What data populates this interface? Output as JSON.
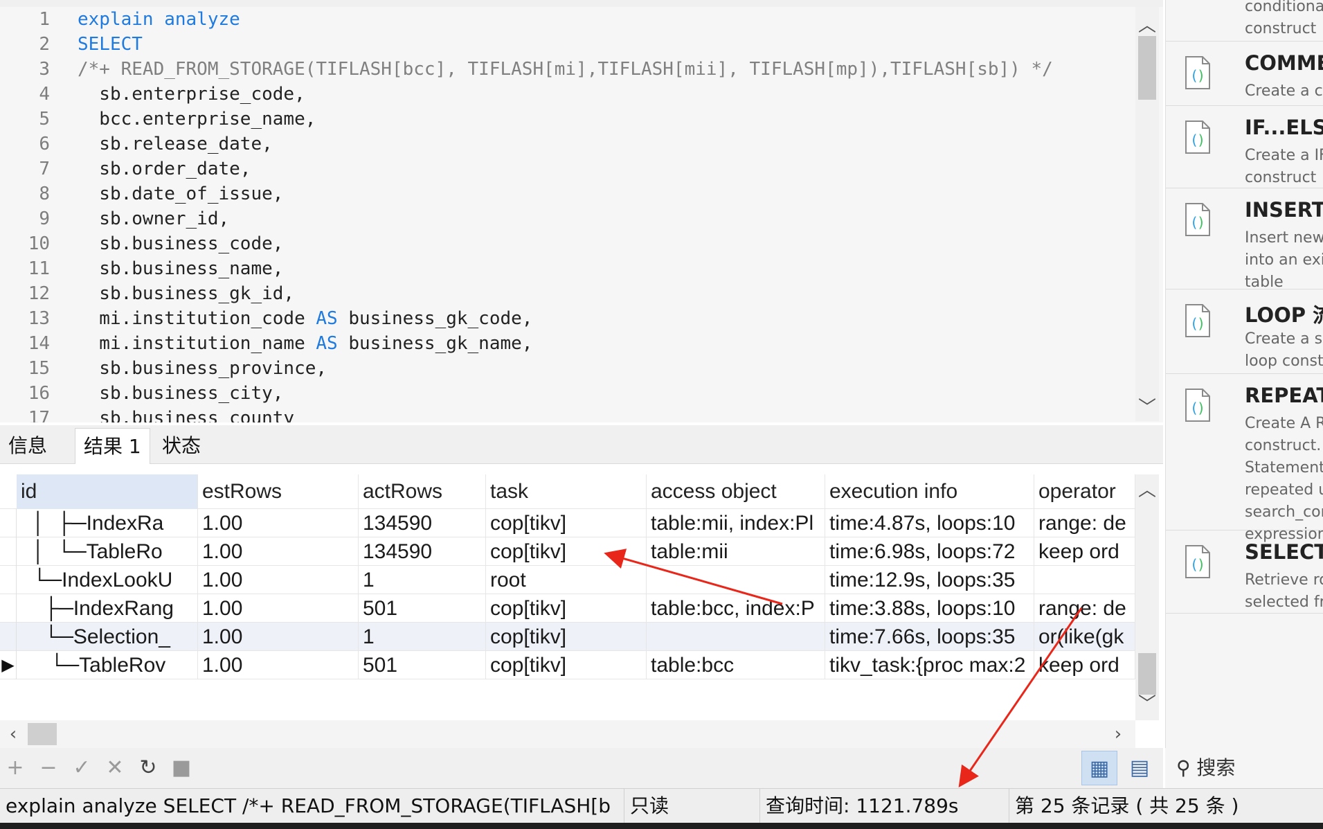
{
  "editor": {
    "lines": [
      {
        "num": "1",
        "parts": [
          {
            "t": "explain analyze",
            "c": "kw"
          }
        ]
      },
      {
        "num": "2",
        "parts": [
          {
            "t": "SELECT",
            "c": "kw"
          }
        ]
      },
      {
        "num": "3",
        "parts": [
          {
            "t": "/*+ READ_FROM_STORAGE(TIFLASH[bcc], TIFLASH[mi],TIFLASH[mii], TIFLASH[mp]),TIFLASH[sb]) */",
            "c": "cm"
          }
        ]
      },
      {
        "num": "4",
        "parts": [
          {
            "t": "  sb.enterprise_code,",
            "c": "tx"
          }
        ]
      },
      {
        "num": "5",
        "parts": [
          {
            "t": "  bcc.enterprise_name,",
            "c": "tx"
          }
        ]
      },
      {
        "num": "6",
        "parts": [
          {
            "t": "  sb.release_date,",
            "c": "tx"
          }
        ]
      },
      {
        "num": "7",
        "parts": [
          {
            "t": "  sb.order_date,",
            "c": "tx"
          }
        ]
      },
      {
        "num": "8",
        "parts": [
          {
            "t": "  sb.date_of_issue,",
            "c": "tx"
          }
        ]
      },
      {
        "num": "9",
        "parts": [
          {
            "t": "  sb.owner_id,",
            "c": "tx"
          }
        ]
      },
      {
        "num": "10",
        "parts": [
          {
            "t": "  sb.business_code,",
            "c": "tx"
          }
        ]
      },
      {
        "num": "11",
        "parts": [
          {
            "t": "  sb.business_name,",
            "c": "tx"
          }
        ]
      },
      {
        "num": "12",
        "parts": [
          {
            "t": "  sb.business_gk_id,",
            "c": "tx"
          }
        ]
      },
      {
        "num": "13",
        "parts": [
          {
            "t": "  mi.institution_code ",
            "c": "tx"
          },
          {
            "t": "AS",
            "c": "kw"
          },
          {
            "t": " business_gk_code,",
            "c": "tx"
          }
        ]
      },
      {
        "num": "14",
        "parts": [
          {
            "t": "  mi.institution_name ",
            "c": "tx"
          },
          {
            "t": "AS",
            "c": "kw"
          },
          {
            "t": " business_gk_name,",
            "c": "tx"
          }
        ]
      },
      {
        "num": "15",
        "parts": [
          {
            "t": "  sb.business_province,",
            "c": "tx"
          }
        ]
      },
      {
        "num": "16",
        "parts": [
          {
            "t": "  sb.business_city,",
            "c": "tx"
          }
        ]
      },
      {
        "num": "17",
        "parts": [
          {
            "t": "  sb.business_county",
            "c": "tx"
          }
        ]
      }
    ]
  },
  "tabs": [
    "信息",
    "结果 1",
    "状态"
  ],
  "active_tab": 1,
  "grid": {
    "columns": [
      "id",
      "estRows",
      "actRows",
      "task",
      "access object",
      "execution info",
      "operator"
    ],
    "rows": [
      [
        "  │  ├─IndexRa",
        "1.00",
        "134590",
        "cop[tikv]",
        "table:mii, index:Pl",
        "time:4.87s, loops:10",
        "range: de"
      ],
      [
        "  │  └─TableRo",
        "1.00",
        "134590",
        "cop[tikv]",
        "table:mii",
        "time:6.98s, loops:72",
        "keep ord"
      ],
      [
        "  └─IndexLookU",
        "1.00",
        "1",
        "root",
        "",
        "time:12.9s, loops:35",
        ""
      ],
      [
        "    ├─IndexRang",
        "1.00",
        "501",
        "cop[tikv]",
        "table:bcc, index:P",
        "time:3.88s, loops:10",
        "range: de"
      ],
      [
        "    └─Selection_",
        "1.00",
        "1",
        "cop[tikv]",
        "",
        "time:7.66s, loops:35",
        "or(like(gk"
      ],
      [
        "     └─TableRov",
        "1.00",
        "501",
        "cop[tikv]",
        "table:bcc",
        "tikv_task:{proc max:2",
        "keep ord"
      ]
    ],
    "current_row_marker": "▶"
  },
  "toolbar": {
    "add": "+",
    "remove": "−",
    "apply": "✓",
    "discard": "✕",
    "refresh": "↻",
    "stop": "■"
  },
  "status": {
    "query": "explain analyze SELECT /*+ READ_FROM_STORAGE(TIFLASH[b",
    "mode": "只读",
    "query_time": "查询时间: 1121.789s",
    "record": "第 25 条记录 ( 共 25 条 )"
  },
  "snippets": [
    {
      "title": "",
      "desc": "conditiona\nconstruct"
    },
    {
      "title": "COMME",
      "desc": "Create a co"
    },
    {
      "title": "IF...ELSE",
      "desc": "Create a IF.\nconstruct"
    },
    {
      "title": "INSERT",
      "desc": "Insert new\ninto an exis\ntable"
    },
    {
      "title": "LOOP 流",
      "desc": "Create a sir\nloop const"
    },
    {
      "title": "REPEAT",
      "desc": "Create A RE\nconstruct.\nStatement\nrepeated u\nsearch_con\nexpression"
    },
    {
      "title": "SELECT",
      "desc": "Retrieve ro\nselected fro"
    }
  ],
  "panel_search": "搜索",
  "colors": {
    "keyword": "#1f7ae0",
    "comment": "#808080",
    "annotation_arrow": "#e8271a",
    "selected_header": "#dde7f5"
  }
}
